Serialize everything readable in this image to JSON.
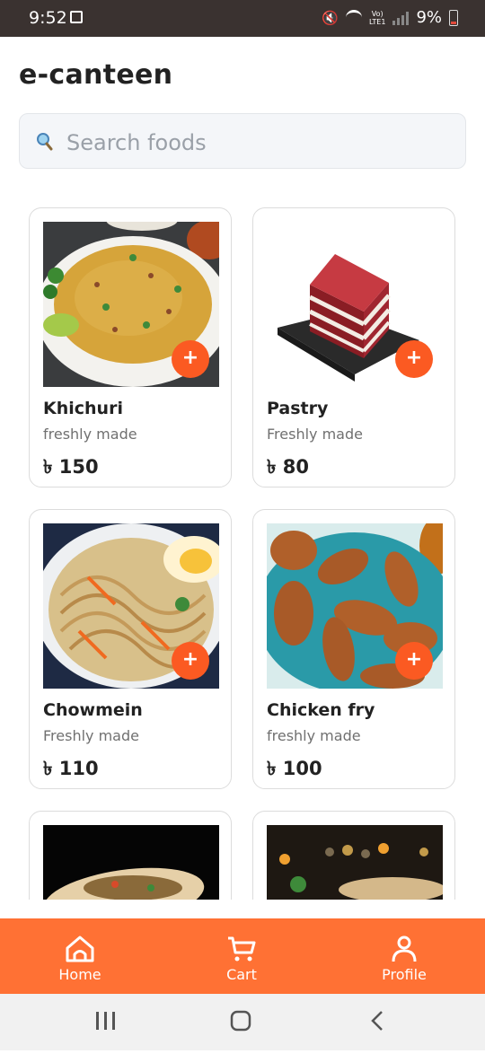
{
  "status_bar": {
    "time": "9:52",
    "battery": "9%",
    "network_label_top": "Vo)",
    "network_label_bottom": "LTE1"
  },
  "app": {
    "title": "e-canteen"
  },
  "search": {
    "placeholder": "Search foods",
    "value": ""
  },
  "foods": [
    {
      "name": "Khichuri",
      "subtitle": "freshly made",
      "price": "৳ 150"
    },
    {
      "name": "Pastry",
      "subtitle": "Freshly made",
      "price": "৳ 80"
    },
    {
      "name": "Chowmein",
      "subtitle": "Freshly made",
      "price": "৳ 110"
    },
    {
      "name": "Chicken fry",
      "subtitle": "freshly made",
      "price": "৳ 100"
    }
  ],
  "add_label": "+",
  "bottom_nav": {
    "home": "Home",
    "cart": "Cart",
    "profile": "Profile"
  },
  "colors": {
    "accent": "#ff7134",
    "add_button": "#fb5a22",
    "status_bar": "#3a3230"
  }
}
